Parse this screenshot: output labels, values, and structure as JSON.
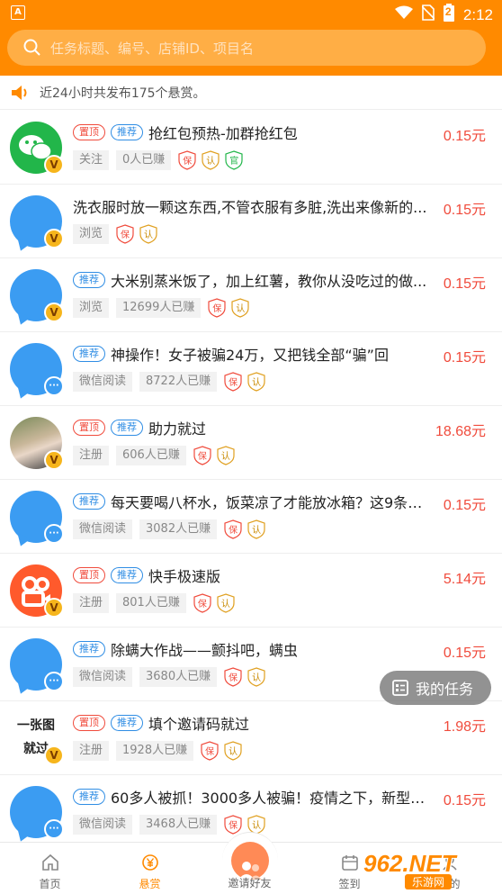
{
  "status_bar": {
    "left_icon_text": "A",
    "battery_level": "2",
    "time": "2:12"
  },
  "search": {
    "placeholder": "任务标题、编号、店铺ID、项目名"
  },
  "notice": {
    "text": "近24小时共发布175个悬赏。"
  },
  "tasks": [
    {
      "pinned_label": "置顶",
      "rec_label": "推荐",
      "title": "抢红包预热-加群抢红包",
      "price": "0.15元",
      "category": "关注",
      "earned": "0人已赚",
      "badges": [
        "保",
        "认",
        "官"
      ],
      "badge_mark": "V"
    },
    {
      "title": "洗衣服时放一颗这东西,不管衣服有多脏,洗出来像新的...",
      "price": "0.15元",
      "category": "浏览",
      "badges": [
        "保",
        "认"
      ],
      "badge_mark": "V"
    },
    {
      "rec_label": "推荐",
      "title": "大米别蒸米饭了，加上红薯，教你从没吃过的做...",
      "price": "0.15元",
      "category": "浏览",
      "earned": "12699人已赚",
      "badges": [
        "保",
        "认"
      ],
      "badge_mark": "V"
    },
    {
      "rec_label": "推荐",
      "title": "神操作！女子被骗24万，又把钱全部“骗”回",
      "price": "0.15元",
      "category": "微信阅读",
      "earned": "8722人已赚",
      "badges": [
        "保",
        "认"
      ]
    },
    {
      "pinned_label": "置顶",
      "rec_label": "推荐",
      "title": "助力就过",
      "price": "18.68元",
      "category": "注册",
      "earned": "606人已赚",
      "badges": [
        "保",
        "认"
      ],
      "badge_mark": "V"
    },
    {
      "rec_label": "推荐",
      "title": "每天要喝八杯水，饭菜凉了才能放冰箱？这9条“...",
      "price": "0.15元",
      "category": "微信阅读",
      "earned": "3082人已赚",
      "badges": [
        "保",
        "认"
      ]
    },
    {
      "pinned_label": "置顶",
      "rec_label": "推荐",
      "title": "快手极速版",
      "price": "5.14元",
      "category": "注册",
      "earned": "801人已赚",
      "badges": [
        "保",
        "认"
      ],
      "badge_mark": "V"
    },
    {
      "rec_label": "推荐",
      "title": "除螨大作战——颤抖吧，螨虫",
      "price": "0.15元",
      "category": "微信阅读",
      "earned": "3680人已赚",
      "badges": [
        "保",
        "认"
      ]
    },
    {
      "pinned_label": "置顶",
      "rec_label": "推荐",
      "title": "填个邀请码就过",
      "price": "1.98元",
      "category": "注册",
      "earned": "1928人已赚",
      "badges": [
        "保",
        "认"
      ],
      "badge_mark": "V",
      "avatar_text": "一张图 就过"
    },
    {
      "rec_label": "推荐",
      "title": "60多人被抓！3000多人被骗！疫情之下，新型“**...",
      "price": "0.15元",
      "category": "微信阅读",
      "earned": "3468人已赚",
      "badges": [
        "保",
        "认"
      ]
    }
  ],
  "fab": {
    "label": "我的任务"
  },
  "tabbar": {
    "items": [
      {
        "label": "首页"
      },
      {
        "label": "悬赏"
      },
      {
        "label": "邀请好友"
      },
      {
        "label": "签到"
      },
      {
        "label": "我的"
      }
    ]
  },
  "watermark": {
    "main": "962.NET",
    "sub": "乐游网"
  },
  "colors": {
    "accent": "#ff8a00",
    "price": "#f04b3c",
    "tag_blue": "#2f8de4"
  }
}
